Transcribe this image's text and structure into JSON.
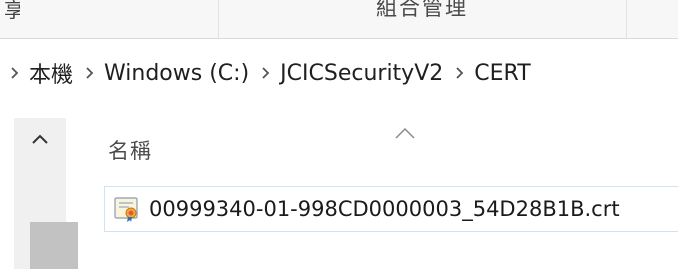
{
  "ribbon": {
    "left_text": "享",
    "group_label": "組合管理"
  },
  "breadcrumb": {
    "items": [
      {
        "label": "本機"
      },
      {
        "label": "Windows (C:)"
      },
      {
        "label": "JCICSecurityV2"
      },
      {
        "label": "CERT"
      }
    ],
    "separator_icon": "chevron-right-icon"
  },
  "file_list": {
    "column_header": "名稱",
    "sort_indicator_icon": "sort-ascending-chevron-icon",
    "files": [
      {
        "name": "00999340-01-998CD0000003_54D28B1B.crt",
        "icon": "certificate-file-icon"
      }
    ]
  },
  "nav_scroll": {
    "up_icon": "scroll-up-arrow-icon"
  },
  "colors": {
    "selection_border": "#cfe3f7",
    "scroll_track": "#f0f0f0",
    "scroll_thumb": "#c2c2c2",
    "ribbon_bg": "#f7f7f7"
  }
}
